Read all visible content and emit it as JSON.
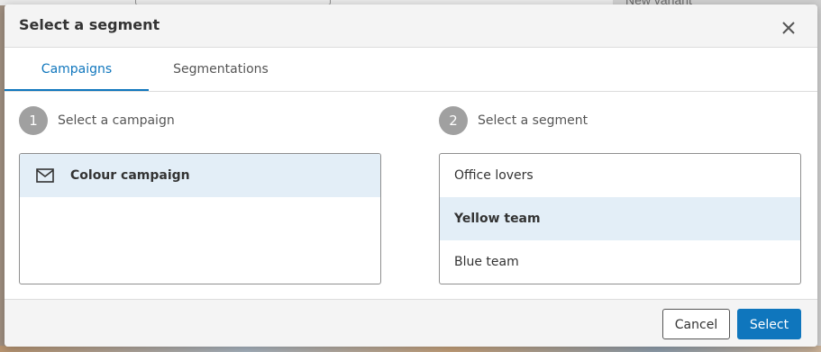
{
  "background": {
    "right_panel_text": "New variant"
  },
  "modal": {
    "title": "Select a segment",
    "close_icon": "close-icon"
  },
  "tabs": [
    {
      "label": "Campaigns",
      "active": true
    },
    {
      "label": "Segmentations",
      "active": false
    }
  ],
  "steps": [
    {
      "number": "1",
      "label": "Select a campaign"
    },
    {
      "number": "2",
      "label": "Select a segment"
    }
  ],
  "campaigns": [
    {
      "label": "Colour campaign",
      "icon": "mail-icon",
      "selected": true
    }
  ],
  "segments": [
    {
      "label": "Office lovers",
      "selected": false
    },
    {
      "label": "Yellow team",
      "selected": true
    },
    {
      "label": "Blue team",
      "selected": false
    }
  ],
  "footer": {
    "cancel_label": "Cancel",
    "select_label": "Select"
  },
  "colors": {
    "accent": "#0f76bd",
    "selected_row": "#e3eef7",
    "step_circle": "#a0a0a0"
  }
}
